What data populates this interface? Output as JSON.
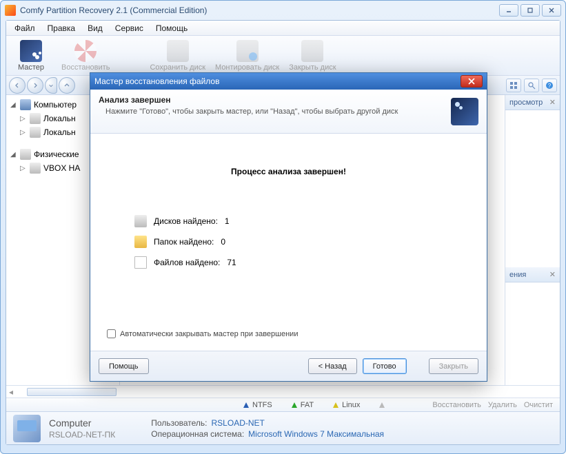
{
  "window": {
    "title": "Comfy Partition Recovery 2.1 (Commercial Edition)"
  },
  "menu": {
    "file": "Файл",
    "edit": "Правка",
    "view": "Вид",
    "service": "Сервис",
    "help": "Помощь"
  },
  "toolbar": {
    "wizard": "Мастер",
    "recover": "Восстановить",
    "save_disk": "Сохранить диск",
    "mount_disk": "Монтировать диск",
    "close_disk": "Закрыть диск"
  },
  "tree": {
    "computer": "Компьютер",
    "local1": "Локальн",
    "local2": "Локальн",
    "physical": "Физические",
    "vbox": "VBOX HA"
  },
  "rightpanel": {
    "preview": "просмотр",
    "info": "ения"
  },
  "fsbar": {
    "ntfs": "NTFS",
    "fat": "FAT",
    "linux": "Linux",
    "recover": "Восстановить",
    "delete": "Удалить",
    "clear": "Очистит"
  },
  "footer": {
    "computer_label": "Computer",
    "hostname": "RSLOAD-NET-ПК",
    "user_label": "Пользователь:",
    "user_value": "RSLOAD-NET",
    "os_label": "Операционная система:",
    "os_value": "Microsoft Windows 7 Максимальная"
  },
  "wizard": {
    "title": "Мастер восстановления файлов",
    "header": "Анализ завершен",
    "sub": "Нажмите \"Готово\", чтобы закрыть мастер, или \"Назад\", чтобы выбрать другой диск",
    "done": "Процесс анализа завершен!",
    "disks_label": "Дисков найдено:",
    "disks_value": "1",
    "folders_label": "Папок найдено:",
    "folders_value": "0",
    "files_label": "Файлов найдено:",
    "files_value": "71",
    "autoclose": "Автоматически закрывать мастер при завершении",
    "help": "Помощь",
    "back": "< Назад",
    "finish": "Готово",
    "close": "Закрыть"
  }
}
